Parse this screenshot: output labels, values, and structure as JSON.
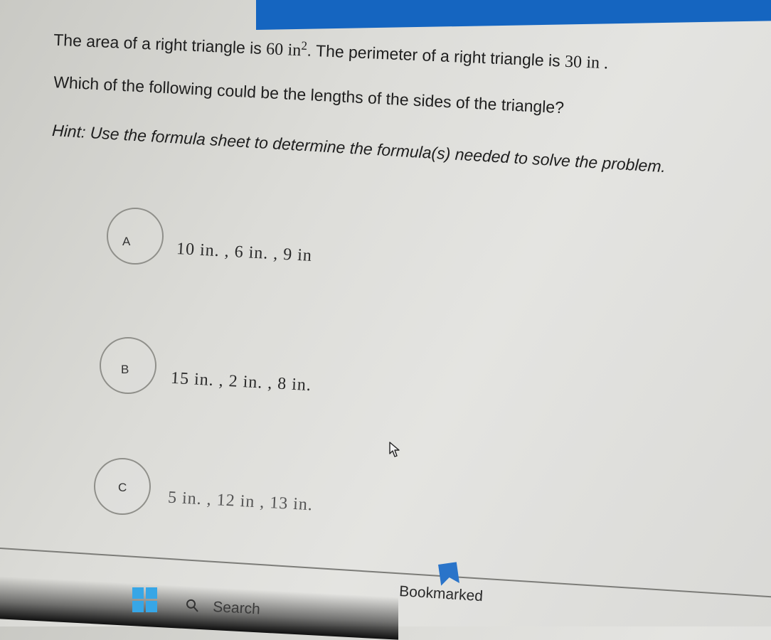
{
  "question": {
    "line1_prefix": "The area of a right triangle is",
    "area_value": "60",
    "area_unit": "in",
    "area_exponent": "2",
    "line1_middle": ". The perimeter of a right triangle is",
    "perimeter_value": "30",
    "perimeter_unit": "in .",
    "line2": "Which of the following could be the lengths of the sides of the triangle?",
    "hint": "Hint: Use the formula sheet to determine the formula(s) needed to solve the problem."
  },
  "choices": [
    {
      "letter": "A",
      "text": "10 in. , 6 in. , 9 in"
    },
    {
      "letter": "B",
      "text": "15 in. , 2 in. , 8 in."
    },
    {
      "letter": "C",
      "text": "5 in. , 12 in , 13 in."
    }
  ],
  "bookmark": {
    "label": "Bookmarked",
    "icon": "bookmark-icon"
  },
  "taskbar": {
    "search_label": "Search",
    "start_icon": "windows-start-icon",
    "search_icon": "search-icon"
  },
  "colors": {
    "accent": "#1565c0",
    "bookmark": "#2a74c9",
    "windows": "#37a6e6"
  }
}
